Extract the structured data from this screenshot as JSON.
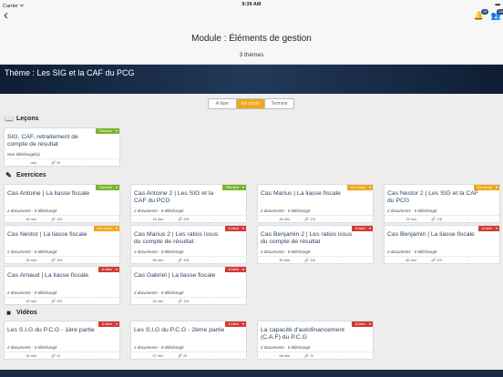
{
  "status": {
    "carrier": "Carrier ᯤ",
    "time": "9:39 AM",
    "battery": "▬"
  },
  "nav": {
    "back": "‹",
    "title": "Module : Éléments de gestion",
    "subtitle": "3 thèmes",
    "badge1": "10",
    "badge2": "100"
  },
  "banner": {
    "title": "Thème : Les SIG et la CAF du PCG"
  },
  "tabs": [
    "A faire",
    "En cours",
    "Terminé"
  ],
  "sections": {
    "lecons": "Leçons",
    "exercices": "Exercices",
    "videos": "Vidéos"
  },
  "lecons": [
    {
      "title": "SIG, CAF, retraitement de compte de résultat",
      "status": "Terminé",
      "docs": "Non téléchargé(s)",
      "duration": "- min",
      "items": "/5",
      "extra": "-"
    }
  ],
  "exercices": [
    {
      "title": "Cas Antoine | La liasse fiscale",
      "status": "Terminé",
      "docs": "2 documents -  0 téléchargé",
      "duration": "30 min",
      "items": "3/3",
      "extra": "-"
    },
    {
      "title": "Cas Antoine 2 | Les SIG et la CAF du PCG",
      "status": "Terminé",
      "docs": "2 documents -  0 téléchargé",
      "duration": "15 min",
      "items": "2/5",
      "extra": "-"
    },
    {
      "title": "Cas Marius | La liasse fiscale",
      "status": "En cours",
      "docs": "2 documents -  0 téléchargé",
      "duration": "45 min",
      "items": "2/3",
      "extra": "-"
    },
    {
      "title": "Cas Nestor 2 | Les SIG et la CAF du PCG",
      "status": "En cours",
      "docs": "2 documents -  0 téléchargé",
      "duration": "15 min",
      "items": "2/5",
      "extra": "-"
    },
    {
      "title": "Cas Nestor | La liasse fiscale",
      "status": "En cours",
      "docs": "2 documents -  0 téléchargé",
      "duration": "30 min",
      "items": "3/3",
      "extra": "-"
    },
    {
      "title": "Cas Marius 2 | Les ratios issus du compte de résultat",
      "status": "A faire",
      "docs": "2 documents -  0 téléchargé",
      "duration": "30 min",
      "items": "3/5",
      "extra": "-"
    },
    {
      "title": "Cas Benjamin 2 | Les ratios issus du compte de résultat",
      "status": "A faire",
      "docs": "2 documents -  0 téléchargé",
      "duration": "30 min",
      "items": "3/5",
      "extra": "-"
    },
    {
      "title": "Cas Benjamin | La liasse fiscale",
      "status": "A faire",
      "docs": "2 documents -  0 téléchargé",
      "duration": "60 min",
      "items": "0/3",
      "extra": "-"
    },
    {
      "title": "Cas Arnaud | La liasse fiscale",
      "status": "A faire",
      "docs": "2 documents -  0 téléchargé",
      "duration": "20 min",
      "items": "3/3",
      "extra": "-"
    },
    {
      "title": "Cas Gabriel | La liasse fiscale",
      "status": "A faire",
      "docs": "2 documents -  0 téléchargé",
      "duration": "20 min",
      "items": "3/3",
      "extra": "-"
    }
  ],
  "videos": [
    {
      "title": "Les S.I.G du P.C.G - 1ère partie",
      "status": "A faire",
      "docs": "2 documents -  0 téléchargé",
      "duration": "32 min",
      "items": "/5",
      "extra": "-"
    },
    {
      "title": "Les S.I.G du P.C.G - 2ème partie",
      "status": "A faire",
      "docs": "2 documents -  0 téléchargé",
      "duration": "37 min",
      "items": "/5",
      "extra": "-"
    },
    {
      "title": "La capacité d'autofinancement (C.A.F) du P.C.G",
      "status": "A faire",
      "docs": "2 documents -  0 téléchargé",
      "duration": "58 min",
      "items": "/5",
      "extra": "-"
    }
  ],
  "colors": {
    "done": "#78b531",
    "in_progress": "#f0a81b",
    "todo": "#d23b34",
    "banner": "#1a2c45"
  },
  "icons": {
    "lecons": "book-icon",
    "exercices": "pencil-icon",
    "videos": "camera-icon"
  }
}
